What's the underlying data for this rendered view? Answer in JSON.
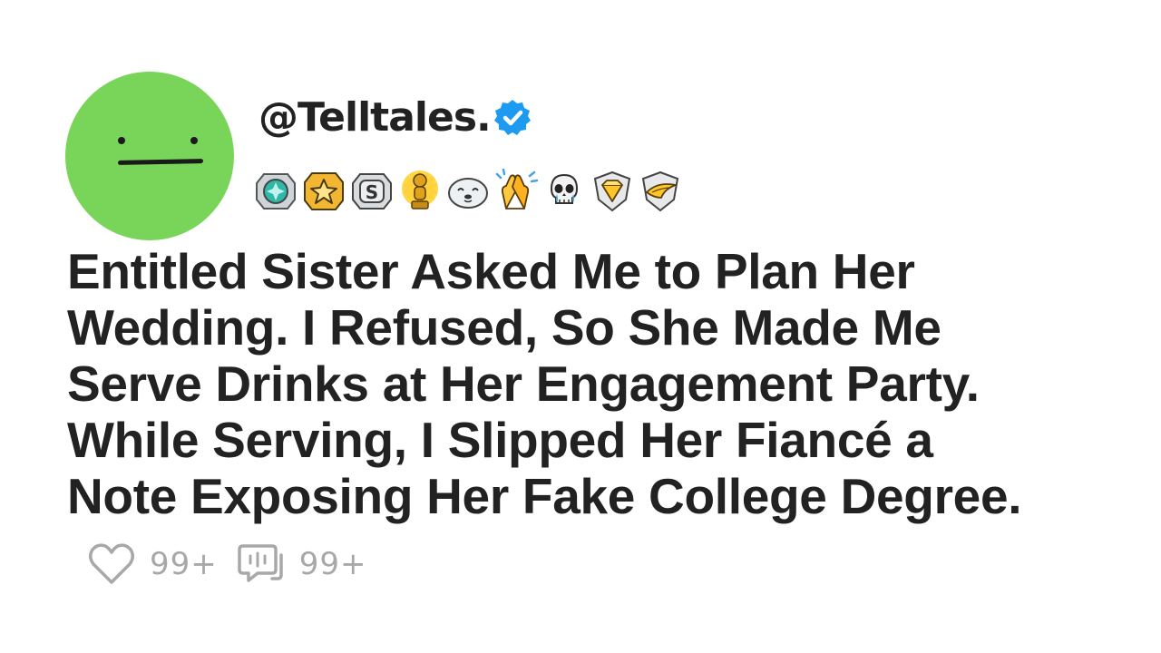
{
  "post": {
    "author": {
      "username": "@Telltales.",
      "verified": true,
      "avatar_color": "#79d55a"
    },
    "badges": [
      {
        "icon": "teal-gem-medal-icon"
      },
      {
        "icon": "gold-star-medal-icon"
      },
      {
        "icon": "silver-s-medal-icon"
      },
      {
        "icon": "gold-trophy-figure-icon"
      },
      {
        "icon": "smiling-seal-icon"
      },
      {
        "icon": "clapping-hands-icon"
      },
      {
        "icon": "crying-skull-icon"
      },
      {
        "icon": "gold-diamond-shield-icon"
      },
      {
        "icon": "gold-wing-shield-icon"
      }
    ],
    "title_lines": [
      "Entitled Sister Asked Me to Plan Her",
      "Wedding. I Refused, So She Made Me",
      "Serve Drinks at Her Engagement Party.",
      "While Serving, I Slipped Her Fiancé a",
      "Note Exposing Her Fake College Degree."
    ],
    "stats": {
      "likes": "99+",
      "comments": "99+"
    }
  },
  "colors": {
    "text": "#222222",
    "verified_blue": "#1d9bf0",
    "stat_gray": "#a8a8a8"
  }
}
